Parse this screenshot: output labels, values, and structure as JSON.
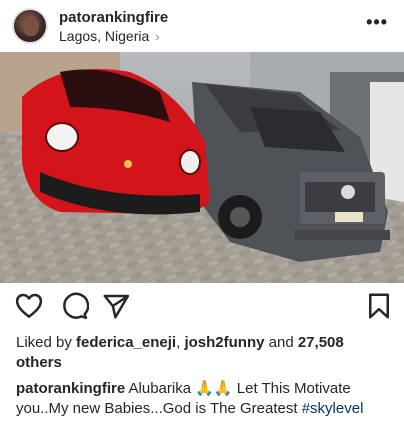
{
  "post": {
    "username": "patorankingfire",
    "location": "Lagos, Nigeria",
    "location_chevron": "›",
    "more_icon": "•••"
  },
  "photo": {
    "description_icon": "image"
  },
  "actions": {
    "like_icon": "heart-icon",
    "comment_icon": "comment-icon",
    "share_icon": "share-icon",
    "save_icon": "bookmark-icon"
  },
  "likes": {
    "prefix": "Liked by ",
    "user1": "federica_eneji",
    "sep": ", ",
    "user2": "josh2funny",
    "and": " and ",
    "count": "27,508",
    "suffix": " others"
  },
  "caption": {
    "username": "patorankingfire",
    "text_before": " Alubarika ",
    "emoji": "🙏🙏",
    "text_after": " Let This Motivate you..My new Babies...God is The Greatest ",
    "hashtag": "#skylevel"
  },
  "colors": {
    "text": "#262626",
    "muted": "#8e8e8e",
    "hashtag": "#003569",
    "car_red": "#d4141b",
    "car_gray": "#5b5e63"
  }
}
